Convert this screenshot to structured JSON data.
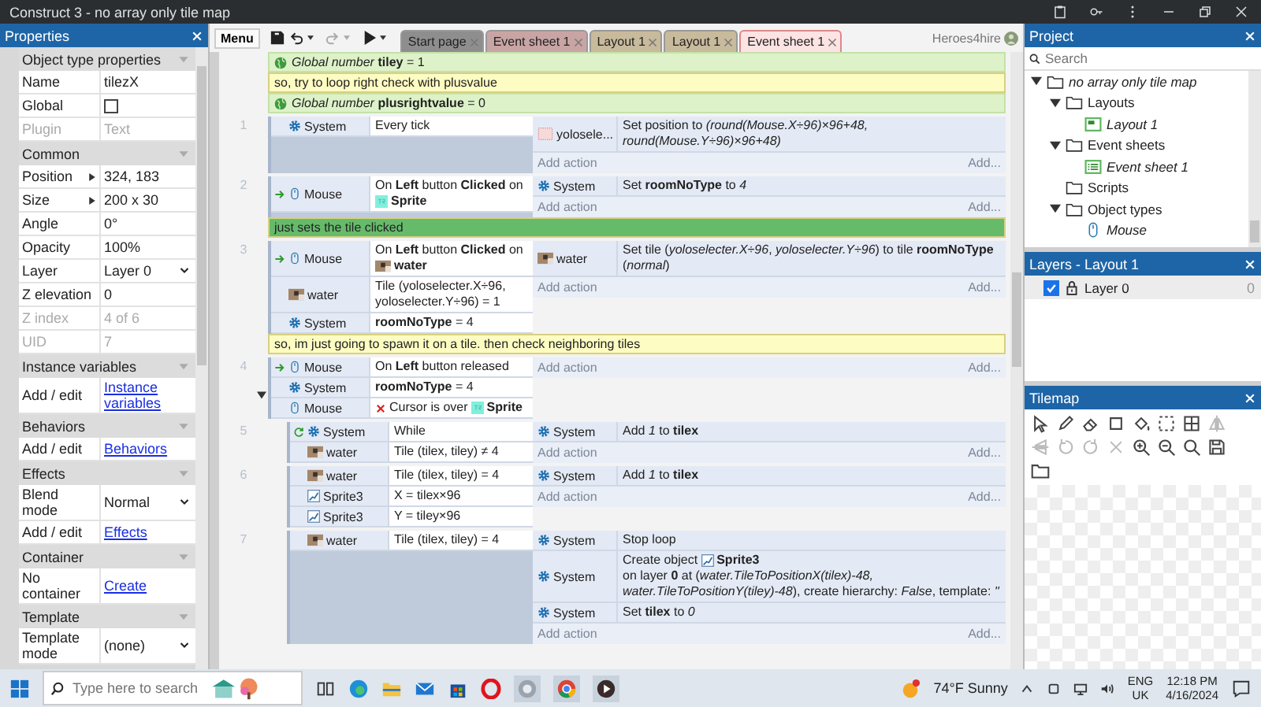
{
  "window": {
    "title": "Construct 3 - no array only tile map"
  },
  "toolbar": {
    "menu": "Menu",
    "tools": [
      {
        "kind": "save",
        "disabled": false
      },
      {
        "kind": "undo",
        "disabled": false
      },
      {
        "kind": "redo",
        "disabled": true
      },
      {
        "kind": "play",
        "disabled": false
      }
    ],
    "tabs": [
      {
        "label": "Start page",
        "color": "#8e8e8e",
        "selected": false
      },
      {
        "label": "Event sheet 1",
        "color": "#c9a4a4",
        "selected": false
      },
      {
        "label": "Layout 1",
        "color": "#c8ba9c",
        "selected": false
      },
      {
        "label": "Layout 1",
        "color": "#c8ba9c",
        "selected": false
      },
      {
        "label": "Event sheet 1",
        "color": "#fde3e3",
        "selected": true
      }
    ],
    "user": "Heroes4hire"
  },
  "properties": {
    "title": "Properties",
    "rows": [
      {
        "kind": "section",
        "label": "Object type properties"
      },
      {
        "kind": "text",
        "name": "Name",
        "value": "tilezX",
        "disabled": false
      },
      {
        "kind": "checkbox",
        "name": "Global",
        "checked": false,
        "disabled": false
      },
      {
        "kind": "text",
        "name": "Plugin",
        "value": "Text",
        "disabled": true
      },
      {
        "kind": "section",
        "label": "Common"
      },
      {
        "kind": "expandable",
        "name": "Position",
        "value": "324, 183",
        "disabled": false
      },
      {
        "kind": "expandable",
        "name": "Size",
        "value": "200 x 30",
        "disabled": false
      },
      {
        "kind": "text",
        "name": "Angle",
        "value": "0°",
        "disabled": false
      },
      {
        "kind": "text",
        "name": "Opacity",
        "value": "100%",
        "disabled": false
      },
      {
        "kind": "dropdown",
        "name": "Layer",
        "value": "Layer 0",
        "disabled": false
      },
      {
        "kind": "text",
        "name": "Z elevation",
        "value": "0",
        "disabled": false
      },
      {
        "kind": "text",
        "name": "Z index",
        "value": "4 of 6",
        "disabled": true
      },
      {
        "kind": "text",
        "name": "UID",
        "value": "7",
        "disabled": true
      },
      {
        "kind": "section",
        "label": "Instance variables"
      },
      {
        "kind": "link",
        "name": "Add / edit",
        "value": "Instance variables",
        "disabled": false
      },
      {
        "kind": "section",
        "label": "Behaviors"
      },
      {
        "kind": "link",
        "name": "Add / edit",
        "value": "Behaviors",
        "disabled": false
      },
      {
        "kind": "section",
        "label": "Effects"
      },
      {
        "kind": "dropdown",
        "name": "Blend mode",
        "value": "Normal",
        "disabled": false
      },
      {
        "kind": "link",
        "name": "Add / edit",
        "value": "Effects",
        "disabled": false
      },
      {
        "kind": "section",
        "label": "Container"
      },
      {
        "kind": "link",
        "name": "No container",
        "value": "Create",
        "disabled": false
      },
      {
        "kind": "section",
        "label": "Template"
      },
      {
        "kind": "dropdown",
        "name": "Template mode",
        "value": "(none)",
        "disabled": false
      }
    ]
  },
  "sheet": {
    "events": [
      {
        "kind": "global",
        "text": "*Global number* **tiley** = 1"
      },
      {
        "kind": "comment",
        "color": "#fdfcc2",
        "text": "so,  try to loop right check with plusvalue"
      },
      {
        "kind": "global",
        "text": "*Global number* **plusrightvalue** = 0"
      },
      {
        "kind": "event",
        "number": "1",
        "conditions": [
          {
            "kind": "system",
            "object": "System",
            "trigger": false,
            "loop": false,
            "inverted": false,
            "text": "Every tick"
          }
        ],
        "actions": [
          {
            "kind": "tiled",
            "object": "yolosele...",
            "text": "Set position to *(round(Mouse.X÷96)×96+48, round(Mouse.Y÷96)×96+48)*"
          }
        ],
        "add_action": "Add action",
        "add_more": "Add..."
      },
      {
        "kind": "event",
        "number": "2",
        "conditions": [
          {
            "kind": "mouse",
            "object": "Mouse",
            "trigger": true,
            "loop": false,
            "inverted": false,
            "text": "On **Left** button **Clicked** on",
            "target": {
              "kind": "sprite",
              "name": "Sprite"
            }
          }
        ],
        "actions": [
          {
            "kind": "system",
            "object": "System",
            "text": "Set **roomNoType** to *4*"
          }
        ],
        "add_action": "Add action",
        "add_more": "Add..."
      },
      {
        "kind": "comment",
        "color": "#66bb6a",
        "text": "just sets the tile clicked"
      },
      {
        "kind": "event",
        "number": "3",
        "conditions": [
          {
            "kind": "mouse",
            "object": "Mouse",
            "trigger": true,
            "loop": false,
            "inverted": false,
            "text": "On **Left** button **Clicked** on",
            "target": {
              "kind": "tilemap",
              "name": "water"
            }
          },
          {
            "kind": "tilemap",
            "object": "water",
            "trigger": false,
            "loop": false,
            "inverted": false,
            "text": "Tile (yoloselecter.X÷96, yoloselecter.Y÷96) = 1"
          },
          {
            "kind": "system",
            "object": "System",
            "trigger": false,
            "loop": false,
            "inverted": false,
            "text": "**roomNoType** = 4"
          }
        ],
        "actions": [
          {
            "kind": "tilemap",
            "object": "water",
            "text": "Set tile (*yoloselecter.X÷96*, *yoloselecter.Y÷96*) to tile **roomNoType** (*normal*)"
          }
        ],
        "add_action": "Add action",
        "add_more": "Add..."
      },
      {
        "kind": "comment",
        "color": "#fdfcc2",
        "text": "so,  im just going to spawn it on a tile.   then check neighboring tiles"
      },
      {
        "kind": "event",
        "number": "4",
        "expanded": true,
        "conditions": [
          {
            "kind": "mouse",
            "object": "Mouse",
            "trigger": true,
            "loop": false,
            "inverted": false,
            "text": "On **Left** button released"
          },
          {
            "kind": "system",
            "object": "System",
            "trigger": false,
            "loop": false,
            "inverted": false,
            "text": "**roomNoType** = 4"
          },
          {
            "kind": "mouse",
            "object": "Mouse",
            "trigger": false,
            "loop": false,
            "inverted": true,
            "text": "Cursor is over",
            "target": {
              "kind": "sprite",
              "name": "Sprite"
            }
          }
        ],
        "add_action": "Add action",
        "add_more": "Add...",
        "children": [
          {
            "kind": "event",
            "number": "5",
            "conditions": [
              {
                "kind": "system",
                "object": "System",
                "trigger": false,
                "loop": true,
                "inverted": false,
                "text": "While"
              },
              {
                "kind": "tilemap",
                "object": "water",
                "trigger": false,
                "loop": false,
                "inverted": false,
                "text": "Tile (tilex, tiley) ≠ 4"
              }
            ],
            "actions": [
              {
                "kind": "system",
                "object": "System",
                "text": "Add *1* to **tilex**"
              }
            ],
            "add_action": "Add action",
            "add_more": "Add..."
          },
          {
            "kind": "event",
            "number": "6",
            "conditions": [
              {
                "kind": "tilemap",
                "object": "water",
                "trigger": false,
                "loop": false,
                "inverted": false,
                "text": "Tile (tilex, tiley) = 4"
              },
              {
                "kind": "sprite3",
                "object": "Sprite3",
                "trigger": false,
                "loop": false,
                "inverted": false,
                "text": "X = tilex×96"
              },
              {
                "kind": "sprite3",
                "object": "Sprite3",
                "trigger": false,
                "loop": false,
                "inverted": false,
                "text": "Y = tiley×96"
              }
            ],
            "actions": [
              {
                "kind": "system",
                "object": "System",
                "text": "Add *1* to **tilex**"
              }
            ],
            "add_action": "Add action",
            "add_more": "Add..."
          },
          {
            "kind": "event",
            "number": "7",
            "conditions": [
              {
                "kind": "tilemap",
                "object": "water",
                "trigger": false,
                "loop": false,
                "inverted": false,
                "text": "Tile (tilex, tiley) = 4"
              }
            ],
            "actions": [
              {
                "kind": "system",
                "object": "System",
                "text": "Stop loop"
              },
              {
                "kind": "system",
                "object": "System",
                "text": "Create object",
                "target": {
                  "kind": "sprite3",
                  "name": "Sprite3"
                },
                "text_after": "on layer **0** at (*water.TileToPositionX(tilex)-48, water.TileToPositionY(tiley)-48*), create hierarchy: *False*, template: *''*"
              },
              {
                "kind": "system",
                "object": "System",
                "text": "Set **tilex** to *0*"
              }
            ],
            "add_action": "Add action",
            "add_more": "Add..."
          }
        ]
      }
    ]
  },
  "project": {
    "title": "Project",
    "search": {
      "placeholder": "Search"
    },
    "tree": [
      {
        "kind": "folder",
        "label": "no array only tile map",
        "italic": true,
        "expanded": true,
        "children": [
          {
            "kind": "folder",
            "label": "Layouts",
            "italic": false,
            "expanded": true,
            "children": [
              {
                "kind": "layout",
                "label": "Layout 1",
                "italic": true
              }
            ]
          },
          {
            "kind": "folder",
            "label": "Event sheets",
            "italic": false,
            "expanded": true,
            "children": [
              {
                "kind": "eventsheet",
                "label": "Event sheet 1",
                "italic": true
              }
            ]
          },
          {
            "kind": "folder",
            "label": "Scripts",
            "italic": false
          },
          {
            "kind": "folder",
            "label": "Object types",
            "italic": false,
            "expanded": true,
            "children": [
              {
                "kind": "mouse",
                "label": "Mouse",
                "italic": true
              }
            ]
          }
        ]
      }
    ]
  },
  "layers": {
    "title": "Layers - Layout 1",
    "items": [
      {
        "name": "Layer 0",
        "visible": true,
        "locked": true,
        "count": "0"
      }
    ]
  },
  "tilemap": {
    "title": "Tilemap",
    "tools": [
      {
        "kind": "select",
        "disabled": false
      },
      {
        "kind": "pencil",
        "disabled": false
      },
      {
        "kind": "eraser",
        "disabled": false
      },
      {
        "kind": "rect",
        "disabled": false
      },
      {
        "kind": "bucket",
        "disabled": false
      },
      {
        "kind": "selectbox",
        "disabled": false
      },
      {
        "kind": "tiles",
        "disabled": false
      },
      {
        "kind": "fliph",
        "disabled": true
      },
      {
        "kind": "flipv",
        "disabled": true
      },
      {
        "kind": "rotccw",
        "disabled": true
      },
      {
        "kind": "rotcw",
        "disabled": true
      },
      {
        "kind": "x",
        "disabled": true
      },
      {
        "kind": "zoomin",
        "disabled": false
      },
      {
        "kind": "zoomout",
        "disabled": false
      },
      {
        "kind": "zoomreset",
        "disabled": false
      },
      {
        "kind": "save",
        "disabled": false
      },
      {
        "kind": "folder",
        "disabled": false
      }
    ]
  },
  "taskbar": {
    "search_placeholder": "Type here to search",
    "weather": "74°F  Sunny",
    "language": "ENG",
    "region": "UK",
    "time": "12:18 PM",
    "date": "4/16/2024"
  }
}
